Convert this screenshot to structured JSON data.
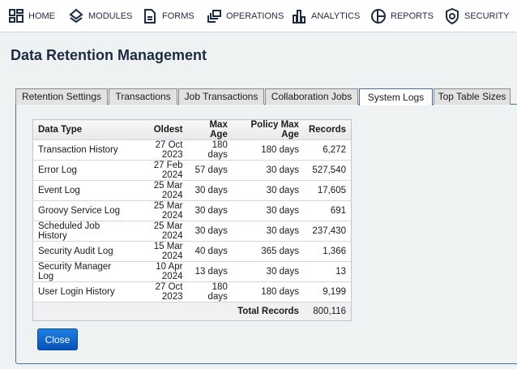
{
  "nav": [
    {
      "label": "HOME",
      "icon": "grid-icon"
    },
    {
      "label": "MODULES",
      "icon": "layers-icon"
    },
    {
      "label": "FORMS",
      "icon": "document-icon"
    },
    {
      "label": "OPERATIONS",
      "icon": "windows-icon"
    },
    {
      "label": "ANALYTICS",
      "icon": "bar-chart-icon"
    },
    {
      "label": "REPORTS",
      "icon": "pie-chart-icon"
    },
    {
      "label": "SECURITY",
      "icon": "shield-icon"
    }
  ],
  "page_title": "Data Retention Management",
  "tabs": [
    "Retention Settings",
    "Transactions",
    "Job Transactions",
    "Collaboration Jobs",
    "System Logs",
    "Top Table Sizes"
  ],
  "active_tab": "System Logs",
  "table": {
    "headers": [
      "Data Type",
      "Oldest",
      "Max Age",
      "Policy Max Age",
      "Records"
    ],
    "rows": [
      [
        "Transaction History",
        "27 Oct 2023",
        "180 days",
        "180 days",
        "6,272"
      ],
      [
        "Error Log",
        "27 Feb 2024",
        "57 days",
        "30 days",
        "527,540"
      ],
      [
        "Event Log",
        "25 Mar 2024",
        "30 days",
        "30 days",
        "17,605"
      ],
      [
        "Groovy Service Log",
        "25 Mar 2024",
        "30 days",
        "30 days",
        "691"
      ],
      [
        "Scheduled Job History",
        "25 Mar 2024",
        "30 days",
        "30 days",
        "237,430"
      ],
      [
        "Security Audit Log",
        "15 Mar 2024",
        "40 days",
        "365 days",
        "1,366"
      ],
      [
        "Security Manager Log",
        "10 Apr 2024",
        "13 days",
        "30 days",
        "13"
      ],
      [
        "User Login History",
        "27 Oct 2023",
        "180 days",
        "180 days",
        "9,199"
      ]
    ],
    "total_label": "Total Records",
    "total_value": "800,116"
  },
  "close_label": "Close"
}
